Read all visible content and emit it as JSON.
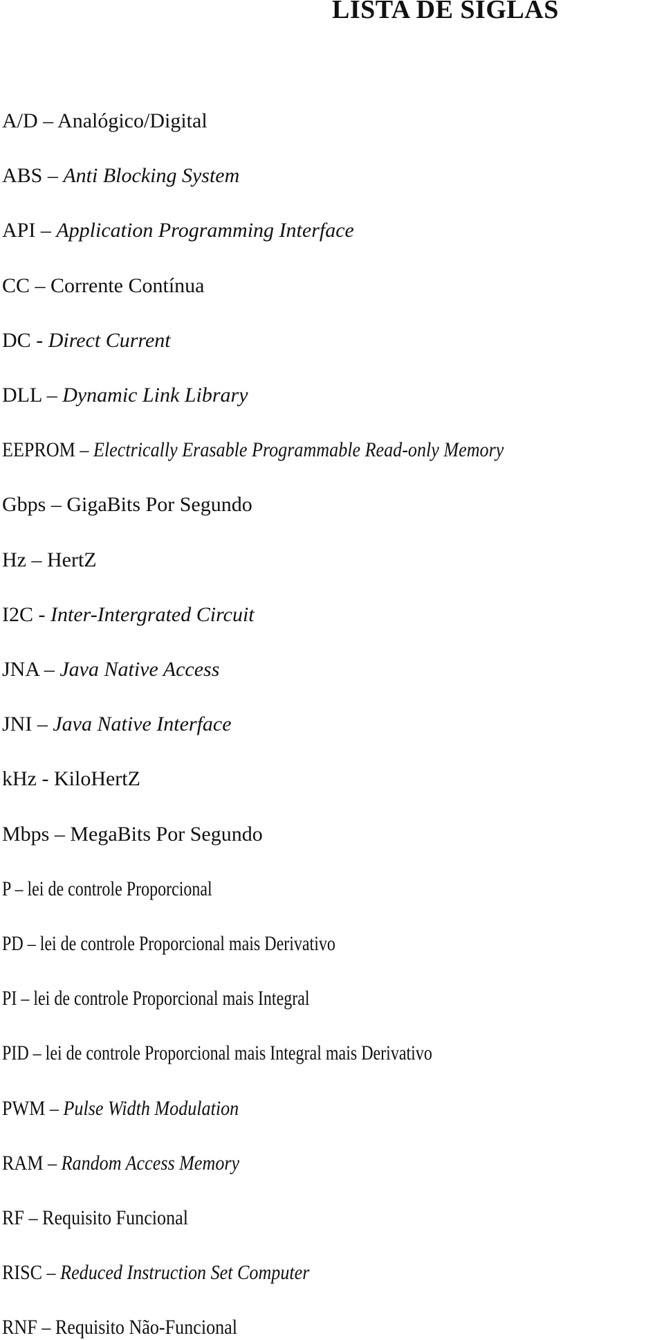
{
  "page": {
    "title": "LISTA DE SIGLAS"
  },
  "acronyms": [
    {
      "acronym": "A/D",
      "sep": " – ",
      "definition": "Analógico/Digital",
      "italic": false
    },
    {
      "acronym": "ABS",
      "sep": " – ",
      "definition": "Anti Blocking System",
      "italic": true
    },
    {
      "acronym": "API",
      "sep": " – ",
      "definition": "Application Programming Interface",
      "italic": true
    },
    {
      "acronym": "CC",
      "sep": " – ",
      "definition": "Corrente Contínua",
      "italic": false
    },
    {
      "acronym": "DC",
      "sep": " - ",
      "definition": "Direct Current",
      "italic": true
    },
    {
      "acronym": "DLL",
      "sep": " – ",
      "definition": "Dynamic Link Library",
      "italic": true
    },
    {
      "acronym": "EEPROM",
      "sep": " – ",
      "definition": "Electrically Erasable Programmable Read-only Memory",
      "italic": true
    },
    {
      "acronym": "Gbps",
      "sep": " – ",
      "definition": "GigaBits Por Segundo",
      "italic": false
    },
    {
      "acronym": "Hz",
      "sep": " – ",
      "definition": "HertZ",
      "italic": false
    },
    {
      "acronym": "I2C",
      "sep": " - ",
      "definition": "Inter-Intergrated Circuit",
      "italic": true
    },
    {
      "acronym": "JNA",
      "sep": " – ",
      "definition": "Java Native Access",
      "italic": true
    },
    {
      "acronym": "JNI",
      "sep": " – ",
      "definition": "Java Native Interface",
      "italic": true
    },
    {
      "acronym": "kHz",
      "sep": " - ",
      "definition": "KiloHertZ",
      "italic": false
    },
    {
      "acronym": "Mbps",
      "sep": " – ",
      "definition": "MegaBits Por Segundo",
      "italic": false
    },
    {
      "acronym": "P",
      "sep": " – ",
      "definition": "lei de controle Proporcional",
      "italic": false
    },
    {
      "acronym": "PD",
      "sep": " – ",
      "definition": "lei de controle Proporcional mais Derivativo",
      "italic": false
    },
    {
      "acronym": "PI",
      "sep": " – ",
      "definition": "lei de controle Proporcional mais Integral",
      "italic": false
    },
    {
      "acronym": "PID",
      "sep": " – ",
      "definition": "lei de controle Proporcional mais Integral mais Derivativo",
      "italic": false
    },
    {
      "acronym": "PWM",
      "sep": " – ",
      "definition": "Pulse Width Modulation",
      "italic": true
    },
    {
      "acronym": "RAM",
      "sep": " – ",
      "definition": "Random Access Memory",
      "italic": true
    },
    {
      "acronym": "RF",
      "sep": " – ",
      "definition": "Requisito Funcional",
      "italic": false
    },
    {
      "acronym": "RISC",
      "sep": " – ",
      "definition": "Reduced Instruction Set Computer",
      "italic": true
    },
    {
      "acronym": "RNF",
      "sep": " – ",
      "definition": "Requisito Não-Funcional",
      "italic": false
    }
  ]
}
